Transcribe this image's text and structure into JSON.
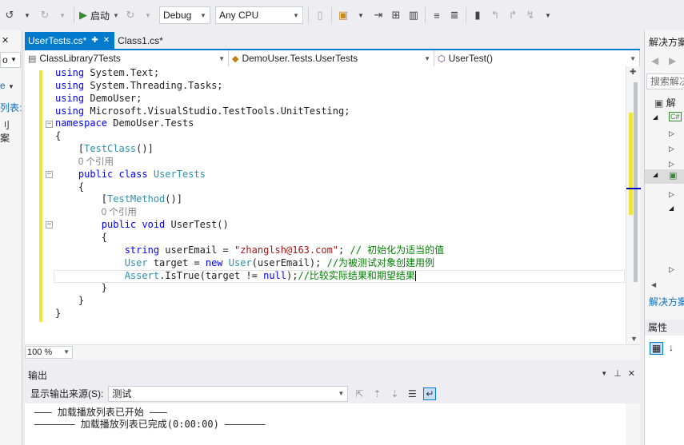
{
  "toolbar": {
    "start_label": "启动",
    "config": "Debug",
    "platform": "Any CPU"
  },
  "left_panel": {
    "search_value": "o",
    "item1": "e",
    "item2": "列表:",
    "item3": "刂",
    "item4": "案"
  },
  "tabs": [
    {
      "label": "UserTests.cs*",
      "pin": "✚",
      "close": "✕"
    },
    {
      "label": "Class1.cs*"
    }
  ],
  "navbar": {
    "project": "ClassLibrary7Tests",
    "class": "DemoUser.Tests.UserTests",
    "member": "UserTest()"
  },
  "code": {
    "l1_kw": "using",
    "l1_rest": " System.Text;",
    "l2_kw": "using",
    "l2_rest": " System.Threading.Tasks;",
    "l3_kw": "using",
    "l3_rest": " DemoUser;",
    "l4_kw": "using",
    "l4_rest": " Microsoft.VisualStudio.TestTools.UnitTesting;",
    "l5_kw": "namespace",
    "l5_rest": " DemoUser.Tests",
    "l6": "{",
    "l7_attr": "TestClass",
    "l8_ref": "0 个引用",
    "l9_kw": "public class",
    "l9_ty": "UserTests",
    "l10": "{",
    "l11_attr": "TestMethod",
    "l12_ref": "0 个引用",
    "l13_kw": "public void",
    "l13_rest": " UserTest()",
    "l14": "{",
    "l15_kw": "string",
    "l15_rest": " userEmail = ",
    "l15_str": "\"zhanglsh@163.com\"",
    "l15_end": ";",
    "l15_cm": " // 初始化为适当的值",
    "l16_ty1": "User",
    "l16_mid": " target = ",
    "l16_kw": "new",
    "l16_ty2": " User",
    "l16_rest": "(userEmail); ",
    "l16_cm": "//为被测试对象创建用例",
    "l17_ty": "Assert",
    "l17_rest": ".IsTrue(target != ",
    "l17_kw": "null",
    "l17_end": ");",
    "l17_cm": "//比较实际结果和期望结果",
    "l18": "}",
    "l19": "}",
    "l20": "}"
  },
  "zoom": "100 %",
  "output": {
    "title": "输出",
    "source_label": "显示输出来源(S):",
    "source_value": "测试",
    "line1": "——— 加载播放列表已开始 ———",
    "line2": "——————— 加载播放列表已完成(0:00:00) ———————"
  },
  "right_panel": {
    "title": "解决方案",
    "search_placeholder": "搜索解决",
    "item_sln": "解",
    "item_cs": "C#",
    "link": "解决方案",
    "properties": "属性"
  },
  "colors": {
    "accent": "#007acc",
    "keyword": "#0000ff",
    "type": "#2b91af",
    "string": "#a31515",
    "comment": "#008000",
    "changebar": "#efe53f"
  }
}
